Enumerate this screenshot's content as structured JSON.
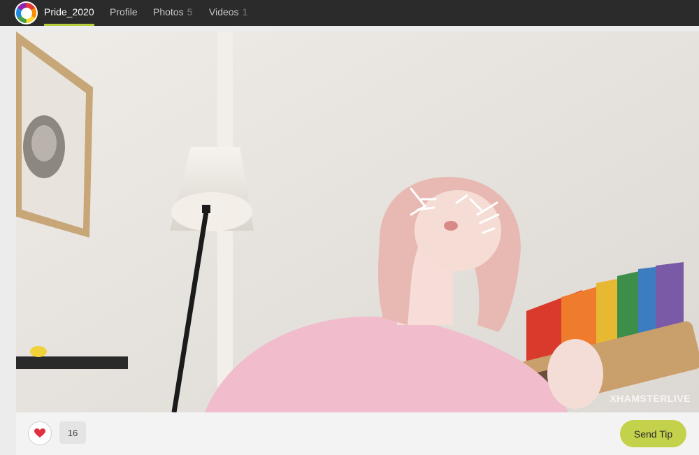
{
  "nav": {
    "profile_name": "Pride_2020",
    "tabs": [
      {
        "label": "Profile",
        "count": ""
      },
      {
        "label": "Photos",
        "count": "5"
      },
      {
        "label": "Videos",
        "count": "1"
      }
    ]
  },
  "photo": {
    "watermark": "XHAMSTERLIVE"
  },
  "footer": {
    "like_icon": "heart-icon",
    "like_count": "16",
    "send_tip_label": "Send Tip"
  },
  "colors": {
    "topbar": "#2b2b2b",
    "accent": "#c4d14a",
    "heart": "#e0303f"
  }
}
